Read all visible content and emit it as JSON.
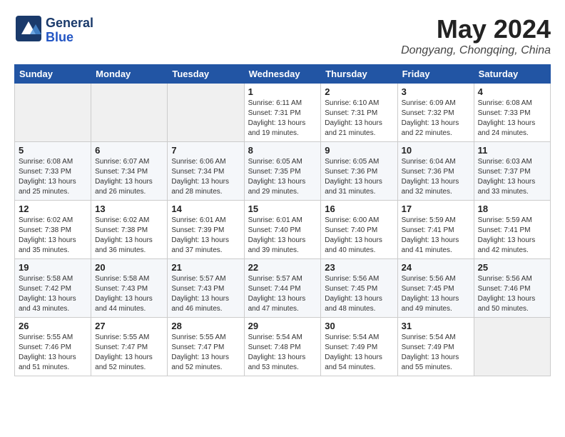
{
  "header": {
    "logo_general": "General",
    "logo_blue": "Blue",
    "month": "May 2024",
    "location": "Dongyang, Chongqing, China"
  },
  "weekdays": [
    "Sunday",
    "Monday",
    "Tuesday",
    "Wednesday",
    "Thursday",
    "Friday",
    "Saturday"
  ],
  "weeks": [
    [
      {
        "day": "",
        "info": ""
      },
      {
        "day": "",
        "info": ""
      },
      {
        "day": "",
        "info": ""
      },
      {
        "day": "1",
        "info": "Sunrise: 6:11 AM\nSunset: 7:31 PM\nDaylight: 13 hours\nand 19 minutes."
      },
      {
        "day": "2",
        "info": "Sunrise: 6:10 AM\nSunset: 7:31 PM\nDaylight: 13 hours\nand 21 minutes."
      },
      {
        "day": "3",
        "info": "Sunrise: 6:09 AM\nSunset: 7:32 PM\nDaylight: 13 hours\nand 22 minutes."
      },
      {
        "day": "4",
        "info": "Sunrise: 6:08 AM\nSunset: 7:33 PM\nDaylight: 13 hours\nand 24 minutes."
      }
    ],
    [
      {
        "day": "5",
        "info": "Sunrise: 6:08 AM\nSunset: 7:33 PM\nDaylight: 13 hours\nand 25 minutes."
      },
      {
        "day": "6",
        "info": "Sunrise: 6:07 AM\nSunset: 7:34 PM\nDaylight: 13 hours\nand 26 minutes."
      },
      {
        "day": "7",
        "info": "Sunrise: 6:06 AM\nSunset: 7:34 PM\nDaylight: 13 hours\nand 28 minutes."
      },
      {
        "day": "8",
        "info": "Sunrise: 6:05 AM\nSunset: 7:35 PM\nDaylight: 13 hours\nand 29 minutes."
      },
      {
        "day": "9",
        "info": "Sunrise: 6:05 AM\nSunset: 7:36 PM\nDaylight: 13 hours\nand 31 minutes."
      },
      {
        "day": "10",
        "info": "Sunrise: 6:04 AM\nSunset: 7:36 PM\nDaylight: 13 hours\nand 32 minutes."
      },
      {
        "day": "11",
        "info": "Sunrise: 6:03 AM\nSunset: 7:37 PM\nDaylight: 13 hours\nand 33 minutes."
      }
    ],
    [
      {
        "day": "12",
        "info": "Sunrise: 6:02 AM\nSunset: 7:38 PM\nDaylight: 13 hours\nand 35 minutes."
      },
      {
        "day": "13",
        "info": "Sunrise: 6:02 AM\nSunset: 7:38 PM\nDaylight: 13 hours\nand 36 minutes."
      },
      {
        "day": "14",
        "info": "Sunrise: 6:01 AM\nSunset: 7:39 PM\nDaylight: 13 hours\nand 37 minutes."
      },
      {
        "day": "15",
        "info": "Sunrise: 6:01 AM\nSunset: 7:40 PM\nDaylight: 13 hours\nand 39 minutes."
      },
      {
        "day": "16",
        "info": "Sunrise: 6:00 AM\nSunset: 7:40 PM\nDaylight: 13 hours\nand 40 minutes."
      },
      {
        "day": "17",
        "info": "Sunrise: 5:59 AM\nSunset: 7:41 PM\nDaylight: 13 hours\nand 41 minutes."
      },
      {
        "day": "18",
        "info": "Sunrise: 5:59 AM\nSunset: 7:41 PM\nDaylight: 13 hours\nand 42 minutes."
      }
    ],
    [
      {
        "day": "19",
        "info": "Sunrise: 5:58 AM\nSunset: 7:42 PM\nDaylight: 13 hours\nand 43 minutes."
      },
      {
        "day": "20",
        "info": "Sunrise: 5:58 AM\nSunset: 7:43 PM\nDaylight: 13 hours\nand 44 minutes."
      },
      {
        "day": "21",
        "info": "Sunrise: 5:57 AM\nSunset: 7:43 PM\nDaylight: 13 hours\nand 46 minutes."
      },
      {
        "day": "22",
        "info": "Sunrise: 5:57 AM\nSunset: 7:44 PM\nDaylight: 13 hours\nand 47 minutes."
      },
      {
        "day": "23",
        "info": "Sunrise: 5:56 AM\nSunset: 7:45 PM\nDaylight: 13 hours\nand 48 minutes."
      },
      {
        "day": "24",
        "info": "Sunrise: 5:56 AM\nSunset: 7:45 PM\nDaylight: 13 hours\nand 49 minutes."
      },
      {
        "day": "25",
        "info": "Sunrise: 5:56 AM\nSunset: 7:46 PM\nDaylight: 13 hours\nand 50 minutes."
      }
    ],
    [
      {
        "day": "26",
        "info": "Sunrise: 5:55 AM\nSunset: 7:46 PM\nDaylight: 13 hours\nand 51 minutes."
      },
      {
        "day": "27",
        "info": "Sunrise: 5:55 AM\nSunset: 7:47 PM\nDaylight: 13 hours\nand 52 minutes."
      },
      {
        "day": "28",
        "info": "Sunrise: 5:55 AM\nSunset: 7:47 PM\nDaylight: 13 hours\nand 52 minutes."
      },
      {
        "day": "29",
        "info": "Sunrise: 5:54 AM\nSunset: 7:48 PM\nDaylight: 13 hours\nand 53 minutes."
      },
      {
        "day": "30",
        "info": "Sunrise: 5:54 AM\nSunset: 7:49 PM\nDaylight: 13 hours\nand 54 minutes."
      },
      {
        "day": "31",
        "info": "Sunrise: 5:54 AM\nSunset: 7:49 PM\nDaylight: 13 hours\nand 55 minutes."
      },
      {
        "day": "",
        "info": ""
      }
    ]
  ]
}
